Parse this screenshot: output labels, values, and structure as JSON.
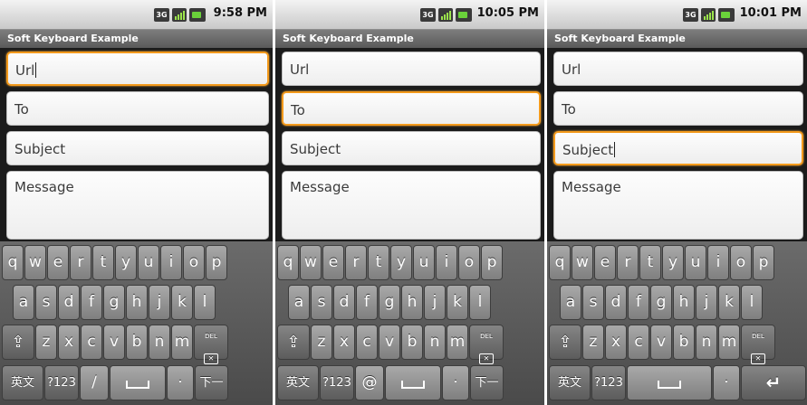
{
  "app_title": "Soft Keyboard Example",
  "screens": [
    {
      "clock": "9:58 PM",
      "fields": {
        "url": "Url",
        "to": "To",
        "subject": "Subject",
        "message": "Message"
      },
      "focused": "url",
      "bottom_row": [
        "英文",
        "?123",
        "/",
        "",
        "·",
        "下一个"
      ]
    },
    {
      "clock": "10:05 PM",
      "fields": {
        "url": "Url",
        "to": "To",
        "subject": "Subject",
        "message": "Message"
      },
      "focused": "to",
      "bottom_row": [
        "英文",
        "?123",
        "@",
        "",
        "·",
        "下一个"
      ]
    },
    {
      "clock": "10:01 PM",
      "fields": {
        "url": "Url",
        "to": "To",
        "subject": "Subject",
        "message": "Message"
      },
      "focused": "subject",
      "bottom_row": [
        "英文",
        "?123",
        "",
        "·",
        "↵"
      ]
    }
  ],
  "keys": {
    "row1": [
      "q",
      "w",
      "e",
      "r",
      "t",
      "y",
      "u",
      "i",
      "o",
      "p"
    ],
    "row2": [
      "a",
      "s",
      "d",
      "f",
      "g",
      "h",
      "j",
      "k",
      "l"
    ],
    "row3": [
      "z",
      "x",
      "c",
      "v",
      "b",
      "n",
      "m"
    ],
    "shift": "⇪",
    "del": "DEL",
    "del_glyph": "✕"
  },
  "status_icons": [
    "3g-icon",
    "signal-icon",
    "battery-icon"
  ],
  "status_3g": "3G",
  "colors": {
    "focus_border": "#f39a1c",
    "title_bar": "#5a5a5a",
    "keyboard": "#4a4a4a"
  }
}
